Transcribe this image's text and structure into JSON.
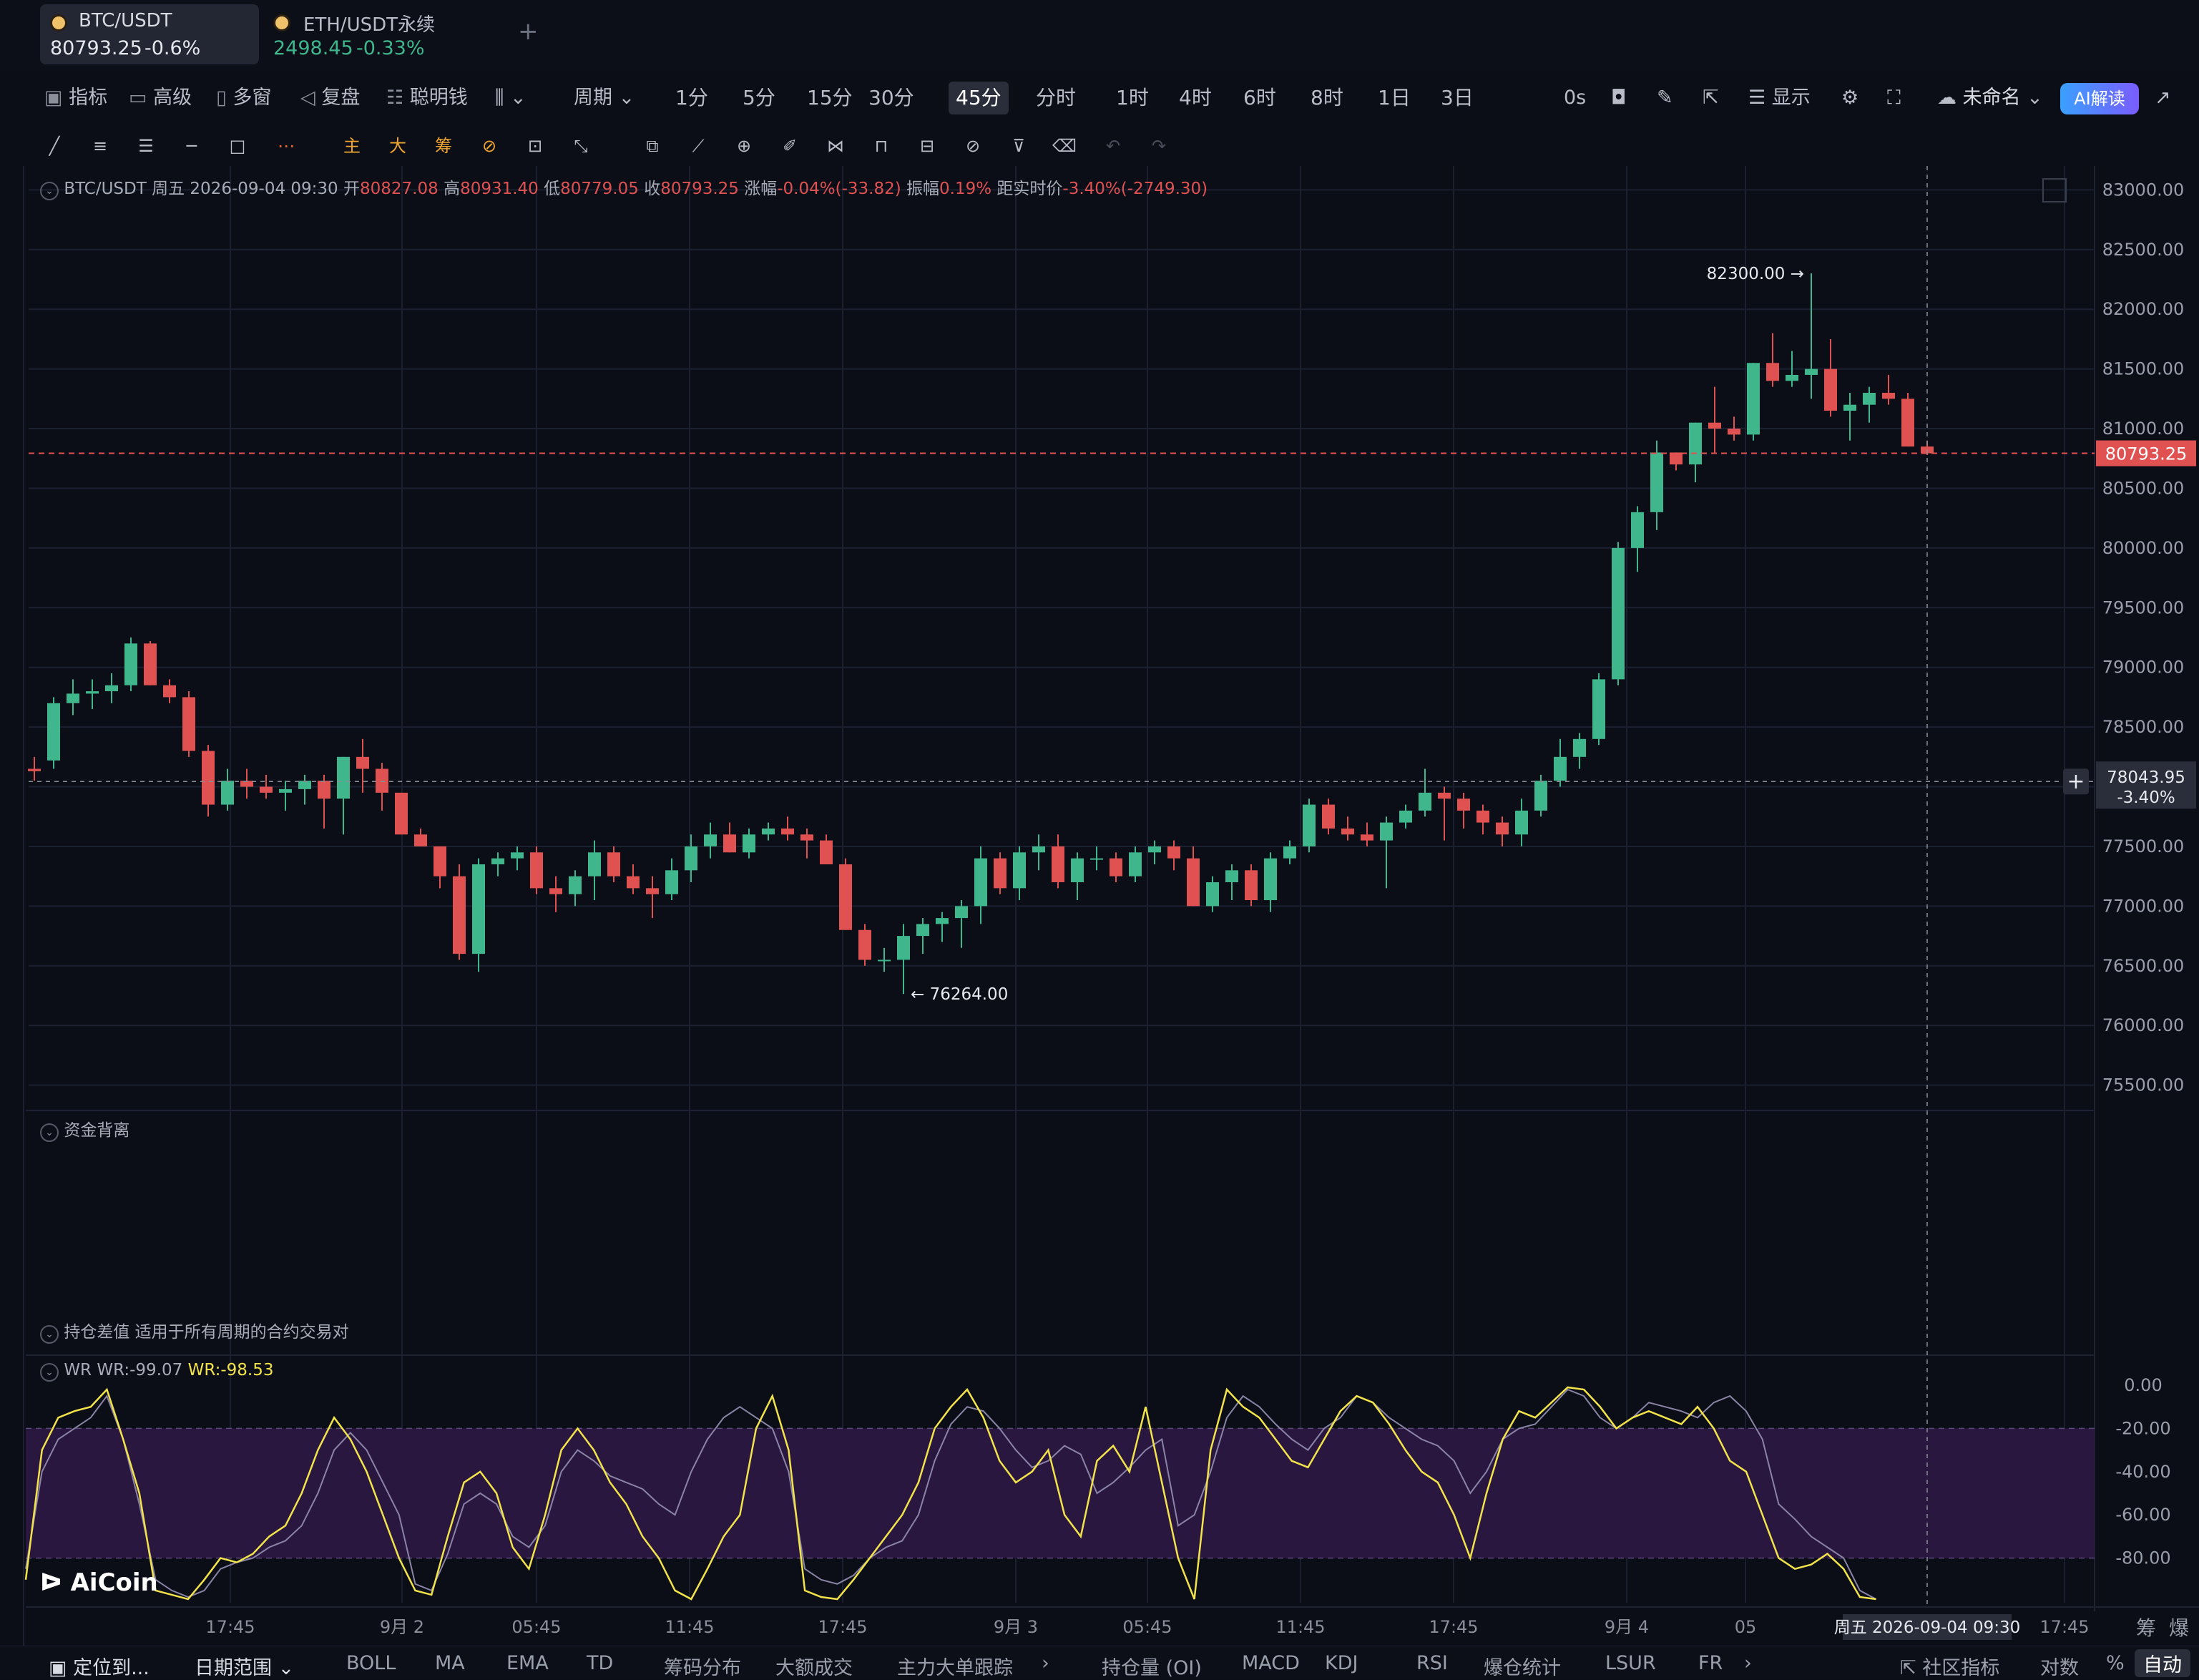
{
  "tabs": [
    {
      "symbol": "BTC/USDT",
      "price": "80793.25",
      "change": "-0.6%"
    },
    {
      "symbol": "ETH/USDT永续",
      "price": "2498.45",
      "change": "-0.33%"
    }
  ],
  "toolbar": {
    "indicators": "指标",
    "advanced": "高级",
    "multi_window": "多窗",
    "replay": "复盘",
    "smart_money": "聪明钱",
    "period": "周期",
    "timeframes": [
      "1分",
      "5分",
      "15分",
      "30分",
      "45分",
      "分时",
      "1时",
      "4时",
      "6时",
      "8时",
      "1日",
      "3日"
    ],
    "active_timeframe": "45分",
    "countdown": "0s",
    "display": "显示",
    "unnamed": "未命名",
    "ai_read": "AI解读"
  },
  "drawing_tools": {
    "main": "主",
    "big": "大",
    "chip": "筹"
  },
  "info_bar": {
    "symbol": "BTC/USDT",
    "datetime": "周五 2026-09-04 09:30",
    "open_label": "开",
    "open": "80827.08",
    "high_label": "高",
    "high": "80931.40",
    "low_label": "低",
    "low": "80779.05",
    "close_label": "收",
    "close": "80793.25",
    "change_label": "涨幅",
    "change": "-0.04%(-33.82)",
    "amp_label": "振幅",
    "amp": "0.19%",
    "dist_label": "距实时价",
    "dist": "-3.40%(-2749.30)"
  },
  "panels": {
    "fund_divergence": "资金背离",
    "oi_diff": "持仓差值",
    "oi_diff_note": "适用于所有周期的合约交易对",
    "wr_name": "WR",
    "wr1": "WR:-99.07",
    "wr2": "WR:-98.53"
  },
  "logo": "AiCoin",
  "colors": {
    "up": "#3fb68b",
    "down": "#e05252",
    "wr1": "#8a84a6",
    "wr2": "#f2e34a",
    "wr_band": "#2a1740"
  },
  "chart_data": [
    {
      "type": "candlestick",
      "title": "BTC/USDT 45分",
      "ylim": [
        75300,
        83200
      ],
      "y_ticks": [
        "83000.00",
        "82500.00",
        "82000.00",
        "81500.00",
        "81000.00",
        "80500.00",
        "80000.00",
        "79500.00",
        "79000.00",
        "78500.00",
        "78000.00",
        "77500.00",
        "77000.00",
        "76500.00",
        "76000.00",
        "75500.00"
      ],
      "x_ticks": [
        "17:45",
        "9月 2",
        "05:45",
        "11:45",
        "17:45",
        "9月 3",
        "05:45",
        "11:45",
        "17:45",
        "9月 4",
        "05",
        "17:45"
      ],
      "last_price": "80793.25",
      "crosshair_price": "78043.95",
      "crosshair_pct": "-3.40%",
      "crosshair_time": "周五 2026-09-04 09:30",
      "max_label": "82300.00",
      "min_label": "76264.00",
      "candles": [
        [
          78150,
          78250,
          78050,
          78130
        ],
        [
          78220,
          78750,
          78150,
          78700
        ],
        [
          78700,
          78900,
          78600,
          78780
        ],
        [
          78780,
          78900,
          78650,
          78800
        ],
        [
          78800,
          78950,
          78700,
          78850
        ],
        [
          78850,
          79250,
          78800,
          79200
        ],
        [
          79200,
          79220,
          78850,
          78850
        ],
        [
          78850,
          78900,
          78700,
          78750
        ],
        [
          78750,
          78800,
          78250,
          78300
        ],
        [
          78300,
          78350,
          77750,
          77850
        ],
        [
          77850,
          78150,
          77800,
          78050
        ],
        [
          78050,
          78150,
          77900,
          78000
        ],
        [
          78000,
          78100,
          77900,
          77950
        ],
        [
          77950,
          78050,
          77800,
          77980
        ],
        [
          77980,
          78100,
          77850,
          78050
        ],
        [
          78050,
          78100,
          77650,
          77900
        ],
        [
          77900,
          78250,
          77600,
          78250
        ],
        [
          78250,
          78400,
          77950,
          78150
        ],
        [
          78150,
          78200,
          77800,
          77950
        ],
        [
          77950,
          77950,
          77600,
          77600
        ],
        [
          77600,
          77650,
          77500,
          77500
        ],
        [
          77500,
          77500,
          77150,
          77250
        ],
        [
          77250,
          77350,
          76550,
          76600
        ],
        [
          76600,
          77400,
          76450,
          77350
        ],
        [
          77350,
          77450,
          77250,
          77400
        ],
        [
          77400,
          77500,
          77300,
          77450
        ],
        [
          77450,
          77500,
          77100,
          77150
        ],
        [
          77150,
          77250,
          76950,
          77100
        ],
        [
          77100,
          77300,
          77000,
          77250
        ],
        [
          77250,
          77550,
          77050,
          77450
        ],
        [
          77450,
          77500,
          77200,
          77250
        ],
        [
          77250,
          77350,
          77100,
          77150
        ],
        [
          77150,
          77250,
          76900,
          77100
        ],
        [
          77100,
          77400,
          77050,
          77300
        ],
        [
          77300,
          77600,
          77200,
          77500
        ],
        [
          77500,
          77700,
          77400,
          77600
        ],
        [
          77600,
          77700,
          77450,
          77450
        ],
        [
          77450,
          77650,
          77400,
          77600
        ],
        [
          77600,
          77700,
          77550,
          77650
        ],
        [
          77650,
          77750,
          77550,
          77600
        ],
        [
          77600,
          77650,
          77400,
          77550
        ],
        [
          77550,
          77600,
          77350,
          77350
        ],
        [
          77350,
          77400,
          76800,
          76800
        ],
        [
          76800,
          76850,
          76500,
          76550
        ],
        [
          76550,
          76650,
          76450,
          76550
        ],
        [
          76550,
          76850,
          76264,
          76750
        ],
        [
          76750,
          76900,
          76600,
          76850
        ],
        [
          76850,
          76950,
          76700,
          76900
        ],
        [
          76900,
          77050,
          76650,
          77000
        ],
        [
          77000,
          77500,
          76850,
          77400
        ],
        [
          77400,
          77450,
          77100,
          77150
        ],
        [
          77150,
          77500,
          77050,
          77450
        ],
        [
          77450,
          77600,
          77300,
          77500
        ],
        [
          77500,
          77600,
          77150,
          77200
        ],
        [
          77200,
          77450,
          77050,
          77400
        ],
        [
          77400,
          77500,
          77300,
          77400
        ],
        [
          77400,
          77450,
          77200,
          77250
        ],
        [
          77250,
          77500,
          77200,
          77450
        ],
        [
          77450,
          77550,
          77350,
          77500
        ],
        [
          77500,
          77550,
          77300,
          77400
        ],
        [
          77400,
          77500,
          77000,
          77000
        ],
        [
          77000,
          77250,
          76950,
          77200
        ],
        [
          77200,
          77350,
          77050,
          77300
        ],
        [
          77300,
          77350,
          77000,
          77050
        ],
        [
          77050,
          77450,
          76950,
          77400
        ],
        [
          77400,
          77550,
          77350,
          77500
        ],
        [
          77500,
          77900,
          77450,
          77850
        ],
        [
          77850,
          77900,
          77600,
          77650
        ],
        [
          77650,
          77750,
          77550,
          77600
        ],
        [
          77600,
          77700,
          77500,
          77550
        ],
        [
          77550,
          77750,
          77150,
          77700
        ],
        [
          77700,
          77850,
          77650,
          77800
        ],
        [
          77800,
          78150,
          77750,
          77950
        ],
        [
          77950,
          78000,
          77550,
          77900
        ],
        [
          77900,
          77950,
          77650,
          77800
        ],
        [
          77800,
          77850,
          77600,
          77700
        ],
        [
          77700,
          77750,
          77500,
          77600
        ],
        [
          77600,
          77900,
          77500,
          77800
        ],
        [
          77800,
          78100,
          77750,
          78050
        ],
        [
          78050,
          78400,
          78000,
          78250
        ],
        [
          78250,
          78450,
          78150,
          78400
        ],
        [
          78400,
          78950,
          78350,
          78900
        ],
        [
          78900,
          80050,
          78850,
          80000
        ],
        [
          80000,
          80350,
          79800,
          80300
        ],
        [
          80300,
          80900,
          80150,
          80800
        ],
        [
          80800,
          80800,
          80650,
          80700
        ],
        [
          80700,
          81050,
          80550,
          81050
        ],
        [
          81050,
          81350,
          80800,
          81000
        ],
        [
          81000,
          81100,
          80900,
          80950
        ],
        [
          80950,
          81550,
          80900,
          81550
        ],
        [
          81550,
          81800,
          81350,
          81400
        ],
        [
          81400,
          81650,
          81350,
          81450
        ],
        [
          81450,
          82300,
          81250,
          81500
        ],
        [
          81500,
          81750,
          81100,
          81150
        ],
        [
          81150,
          81300,
          80900,
          81200
        ],
        [
          81200,
          81350,
          81050,
          81300
        ],
        [
          81300,
          81450,
          81200,
          81250
        ],
        [
          81250,
          81300,
          80850,
          80850
        ],
        [
          80850,
          80900,
          80779,
          80793
        ]
      ]
    },
    {
      "type": "line",
      "title": "WR",
      "ylim": [
        -100,
        0
      ],
      "y_ticks": [
        "0.00",
        "-20.00",
        "-40.00",
        "-60.00",
        "-80.00"
      ],
      "series": [
        {
          "name": "WR:-99.07",
          "values": [
            -85,
            -40,
            -25,
            -20,
            -15,
            -5,
            -25,
            -55,
            -90,
            -95,
            -98,
            -95,
            -85,
            -82,
            -80,
            -75,
            -72,
            -65,
            -50,
            -30,
            -22,
            -30,
            -45,
            -60,
            -92,
            -95,
            -78,
            -55,
            -50,
            -55,
            -70,
            -75,
            -65,
            -40,
            -30,
            -35,
            -42,
            -45,
            -48,
            -55,
            -60,
            -40,
            -25,
            -15,
            -10,
            -15,
            -20,
            -40,
            -85,
            -90,
            -92,
            -88,
            -80,
            -75,
            -72,
            -60,
            -35,
            -18,
            -10,
            -12,
            -20,
            -30,
            -38,
            -35,
            -28,
            -32,
            -50,
            -45,
            -38,
            -30,
            -25,
            -65,
            -60,
            -40,
            -15,
            -5,
            -10,
            -18,
            -25,
            -30,
            -20,
            -15,
            -5,
            -8,
            -15,
            -20,
            -25,
            -28,
            -35,
            -50,
            -40,
            -25,
            -20,
            -18,
            -10,
            -2,
            -5,
            -15,
            -20,
            -15,
            -8,
            -10,
            -12,
            -15,
            -8,
            -5,
            -12,
            -25,
            -55,
            -62,
            -70,
            -75,
            -80,
            -95,
            -99
          ]
        },
        {
          "name": "WR:-98.53",
          "values": [
            -90,
            -30,
            -15,
            -12,
            -10,
            -2,
            -25,
            -50,
            -95,
            -97,
            -99,
            -90,
            -80,
            -82,
            -78,
            -70,
            -65,
            -50,
            -30,
            -15,
            -25,
            -40,
            -60,
            -80,
            -95,
            -97,
            -70,
            -45,
            -40,
            -50,
            -75,
            -85,
            -60,
            -30,
            -20,
            -30,
            -45,
            -55,
            -70,
            -80,
            -95,
            -99,
            -85,
            -70,
            -60,
            -20,
            -5,
            -30,
            -95,
            -98,
            -99,
            -90,
            -80,
            -70,
            -60,
            -45,
            -20,
            -10,
            -2,
            -15,
            -35,
            -45,
            -40,
            -30,
            -60,
            -70,
            -35,
            -28,
            -40,
            -10,
            -45,
            -80,
            -99,
            -30,
            -2,
            -10,
            -15,
            -25,
            -35,
            -38,
            -25,
            -12,
            -5,
            -8,
            -18,
            -30,
            -40,
            -45,
            -60,
            -80,
            -50,
            -25,
            -12,
            -15,
            -8,
            -1,
            -2,
            -10,
            -20,
            -15,
            -12,
            -15,
            -18,
            -10,
            -20,
            -35,
            -40,
            -60,
            -80,
            -85,
            -83,
            -78,
            -85,
            -98,
            -99
          ]
        }
      ]
    }
  ],
  "bottom_bar": {
    "locate": "定位到...",
    "date_range": "日期范围",
    "indicators": [
      "BOLL",
      "MA",
      "EMA",
      "TD",
      "筹码分布",
      "大额成交",
      "主力大单跟踪"
    ],
    "indicators2": [
      "持仓量 (OI)",
      "MACD",
      "KDJ",
      "RSI",
      "爆仓统计",
      "LSUR",
      "FR"
    ],
    "community": "社区指标",
    "log": "对数",
    "pct": "%",
    "auto": "自动",
    "chip_label": "筹",
    "liq_label": "爆"
  }
}
